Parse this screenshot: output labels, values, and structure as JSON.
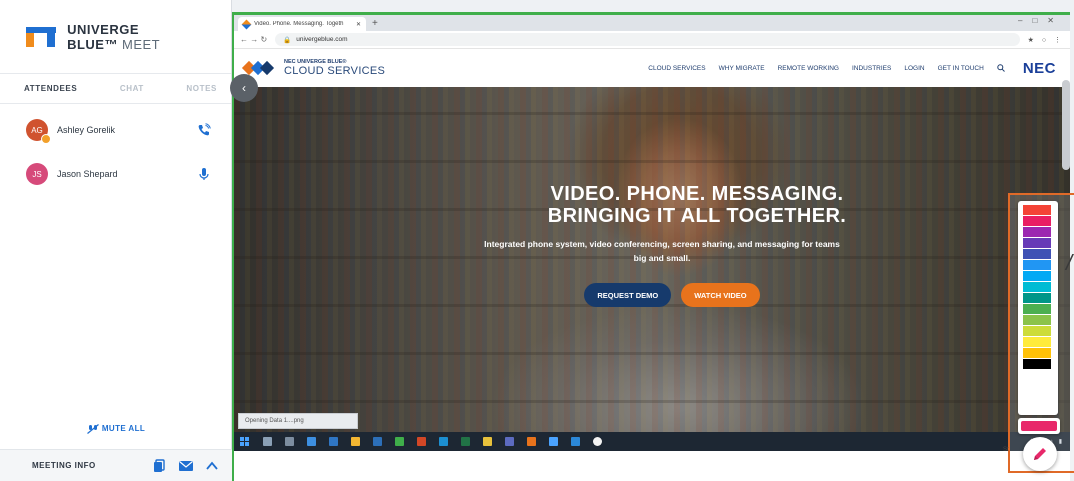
{
  "meet": {
    "brand": "UNIVERGE BLUE",
    "brand_tm": "™",
    "brand_suffix": "MEET",
    "tabs": [
      "ATTENDEES",
      "CHAT",
      "NOTES"
    ],
    "attendees": [
      {
        "initials": "AG",
        "name": "Ashley Gorelik",
        "color": "#d0532f",
        "status": "phone"
      },
      {
        "initials": "JS",
        "name": "Jason Shepard",
        "color": "#d64a7a",
        "status": "mic"
      }
    ],
    "mute_all": "MUTE ALL",
    "meeting_info": "MEETING INFO",
    "accent": "#1f6fd1"
  },
  "browser": {
    "tab_title": "Video. Phone. Messaging. Togeth",
    "new_tab": "+",
    "url": "univergeblue.com",
    "download_item": "Opening Data 1....png",
    "stop_label": "St"
  },
  "site": {
    "brand_small": "NEC UNIVERGE BLUE®",
    "brand_big": "CLOUD SERVICES",
    "nav": [
      "CLOUD SERVICES",
      "WHY MIGRATE",
      "REMOTE WORKING",
      "INDUSTRIES",
      "LOGIN",
      "GET IN TOUCH"
    ],
    "nec_logo": "NEC",
    "headline_1": "VIDEO. PHONE. MESSAGING.",
    "headline_2": "BRINGING IT ALL TOGETHER.",
    "subtext": "Integrated phone system, video conferencing, screen sharing, and messaging for teams big and small.",
    "cta_demo": "REQUEST DEMO",
    "cta_video": "WATCH VIDEO"
  },
  "palette": {
    "colors": [
      "#f44336",
      "#e91e63",
      "#9c27b0",
      "#673ab7",
      "#3f51b5",
      "#2196f3",
      "#03a9f4",
      "#00bcd4",
      "#009688",
      "#4caf50",
      "#8bc34a",
      "#cddc39",
      "#ffeb3b",
      "#ffc107",
      "#000000"
    ],
    "selected": "#e8286a",
    "frame_color": "#e06a28"
  }
}
